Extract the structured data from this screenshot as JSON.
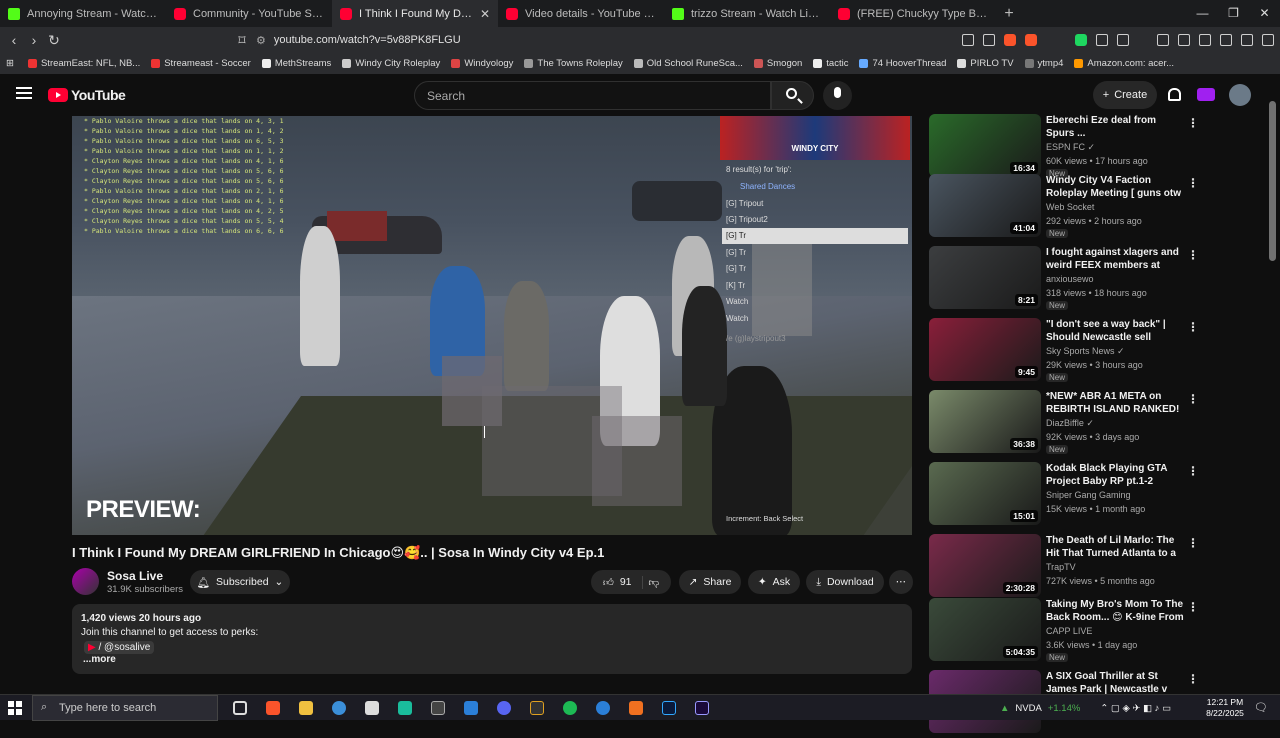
{
  "browser": {
    "tabs": [
      {
        "label": "Annoying Stream - Watch Live on Kick",
        "favicon": "kick"
      },
      {
        "label": "Community - YouTube Studio",
        "favicon": "youtube"
      },
      {
        "label": "I Think I Found My DREAM G",
        "favicon": "youtube",
        "active": true
      },
      {
        "label": "Video details - YouTube Studio",
        "favicon": "youtube"
      },
      {
        "label": "trizzo Stream - Watch Live on Kick",
        "favicon": "kick"
      },
      {
        "label": "(FREE) Chuckyy Type Beat - \"I DON'T",
        "favicon": "youtube"
      }
    ],
    "url": "youtube.com/watch?v=5v88PK8FLGU",
    "bookmarks": [
      "StreamEast: NFL, NB...",
      "Streameast - Soccer",
      "MethStreams",
      "Windy City Roleplay",
      "Windyology",
      "The Towns Roleplay",
      "Old School RuneSca...",
      "Smogon",
      "tactic",
      "74 HooverThread",
      "PIRLO TV",
      "ytmp4",
      "Amazon.com: acer..."
    ]
  },
  "yt": {
    "logo": "YouTube",
    "search_placeholder": "Search",
    "create_label": "Create"
  },
  "video": {
    "chat_lines": [
      "* Pablo Valoire throws a dice that lands on 4, 3, 1",
      "* Pablo Valoire throws a dice that lands on 1, 4, 2",
      "* Pablo Valoire throws a dice that lands on 6, 5, 3",
      "* Pablo Valoire throws a dice that lands on 1, 1, 2",
      "* Clayton Reyes throws a dice that lands on 4, 1, 6",
      "* Clayton Reyes throws a dice that lands on 5, 6, 6",
      "* Clayton Reyes throws a dice that lands on 5, 6, 6",
      "* Pablo Valoire throws a dice that lands on 2, 1, 6",
      "* Clayton Reyes throws a dice that lands on 4, 1, 6",
      "* Clayton Reyes throws a dice that lands on 4, 2, 5",
      "* Clayton Reyes throws a dice that lands on 5, 5, 4",
      "* Pablo Valoire throws a dice that lands on 6, 6, 6"
    ],
    "menu_banner": "WINDY CITY",
    "menu_results": "8 result(s) for 'trip':",
    "menu_items": [
      "Shared Dances",
      "[G] Tripout",
      "[G] Tripout2",
      "[G] Tr",
      "[G] Tr",
      "[G] Tr",
      "[K] Tr",
      "Watch",
      "Watch",
      "/e (g)laystripout3"
    ],
    "preview_label": "PREVIEW:",
    "menu_hint": "Increment:   Back   Select",
    "title": "I Think I Found My DREAM GIRLFRIEND In Chicago😍🥰.. | Sosa In Windy City v4 Ep.1",
    "channel": "Sosa Live",
    "subs": "31.9K subscribers",
    "subscribed_label": "Subscribed",
    "likes": "91",
    "share_label": "Share",
    "ask_label": "Ask",
    "download_label": "Download",
    "views_line": "1,420 views  20 hours ago",
    "desc_join": "Join this channel to get access to perks:",
    "desc_handle": "/ @sosalive",
    "desc_more": "...more"
  },
  "recs": [
    {
      "title": "Eberechi Eze deal from Spurs ...",
      "channel": "ESPN FC ✓",
      "meta": "60K views • 17 hours ago",
      "badge": "New",
      "dur": "16:34",
      "color": "#2a6b2a"
    },
    {
      "title": "Windy City V4 Faction Roleplay Meeting [ guns otw ]",
      "channel": "Web Socket",
      "meta": "292 views • 2 hours ago",
      "badge": "New",
      "dur": "41:04",
      "color": "#4a5560"
    },
    {
      "title": "I fought against xlagers and weird FEEX members at airpor...",
      "channel": "anxiousewo",
      "meta": "318 views • 18 hours ago",
      "badge": "New",
      "dur": "8:21",
      "color": "#3c3e40"
    },
    {
      "title": "\"I don't see a way back\" | Should Newcastle sell Alexander Isak ...",
      "channel": "Sky Sports News ✓",
      "meta": "29K views • 3 hours ago",
      "badge": "New",
      "dur": "9:45",
      "color": "#8a1f3a"
    },
    {
      "title": "*NEW* ABR A1 META on REBIRTH ISLAND RANKED! ...",
      "channel": "DiazBiffle ✓",
      "meta": "92K views • 3 days ago",
      "badge": "New",
      "dur": "36:38",
      "color": "#7a8a6a"
    },
    {
      "title": "Kodak Black Playing GTA Project Baby RP pt.1-2",
      "channel": "Sniper Gang Gaming",
      "meta": "15K views • 1 month ago",
      "badge": "",
      "dur": "15:01",
      "color": "#5a6a50"
    },
    {
      "title": "The Death of Lil Marlo: The Hit That Turned Atlanta to a ...",
      "channel": "TrapTV",
      "meta": "727K views • 5 months ago",
      "badge": "",
      "dur": "2:30:28",
      "color": "#7a2a4a"
    },
    {
      "title": "Taking My Bro's Mom To The Back Room... 😊 K-9ine From ...",
      "channel": "CAPP LIVE",
      "meta": "3.6K views • 1 day ago",
      "badge": "New",
      "dur": "5:04:35",
      "color": "#3a4a3a"
    },
    {
      "title": "A SIX Goal Thriller at St James Park | Newcastle v Liverpool ...",
      "channel": "",
      "meta": "",
      "badge": "",
      "dur": "",
      "color": "#6a2a6a"
    }
  ],
  "taskbar": {
    "search_placeholder": "Type here to search",
    "stock": "NVDA",
    "stock_change": "+1.14%",
    "time": "12:21 PM",
    "date": "8/22/2025"
  },
  "colors": {
    "youtube_red": "#ff0033",
    "kick_green": "#53fc18",
    "stock_green": "#4caf50"
  }
}
